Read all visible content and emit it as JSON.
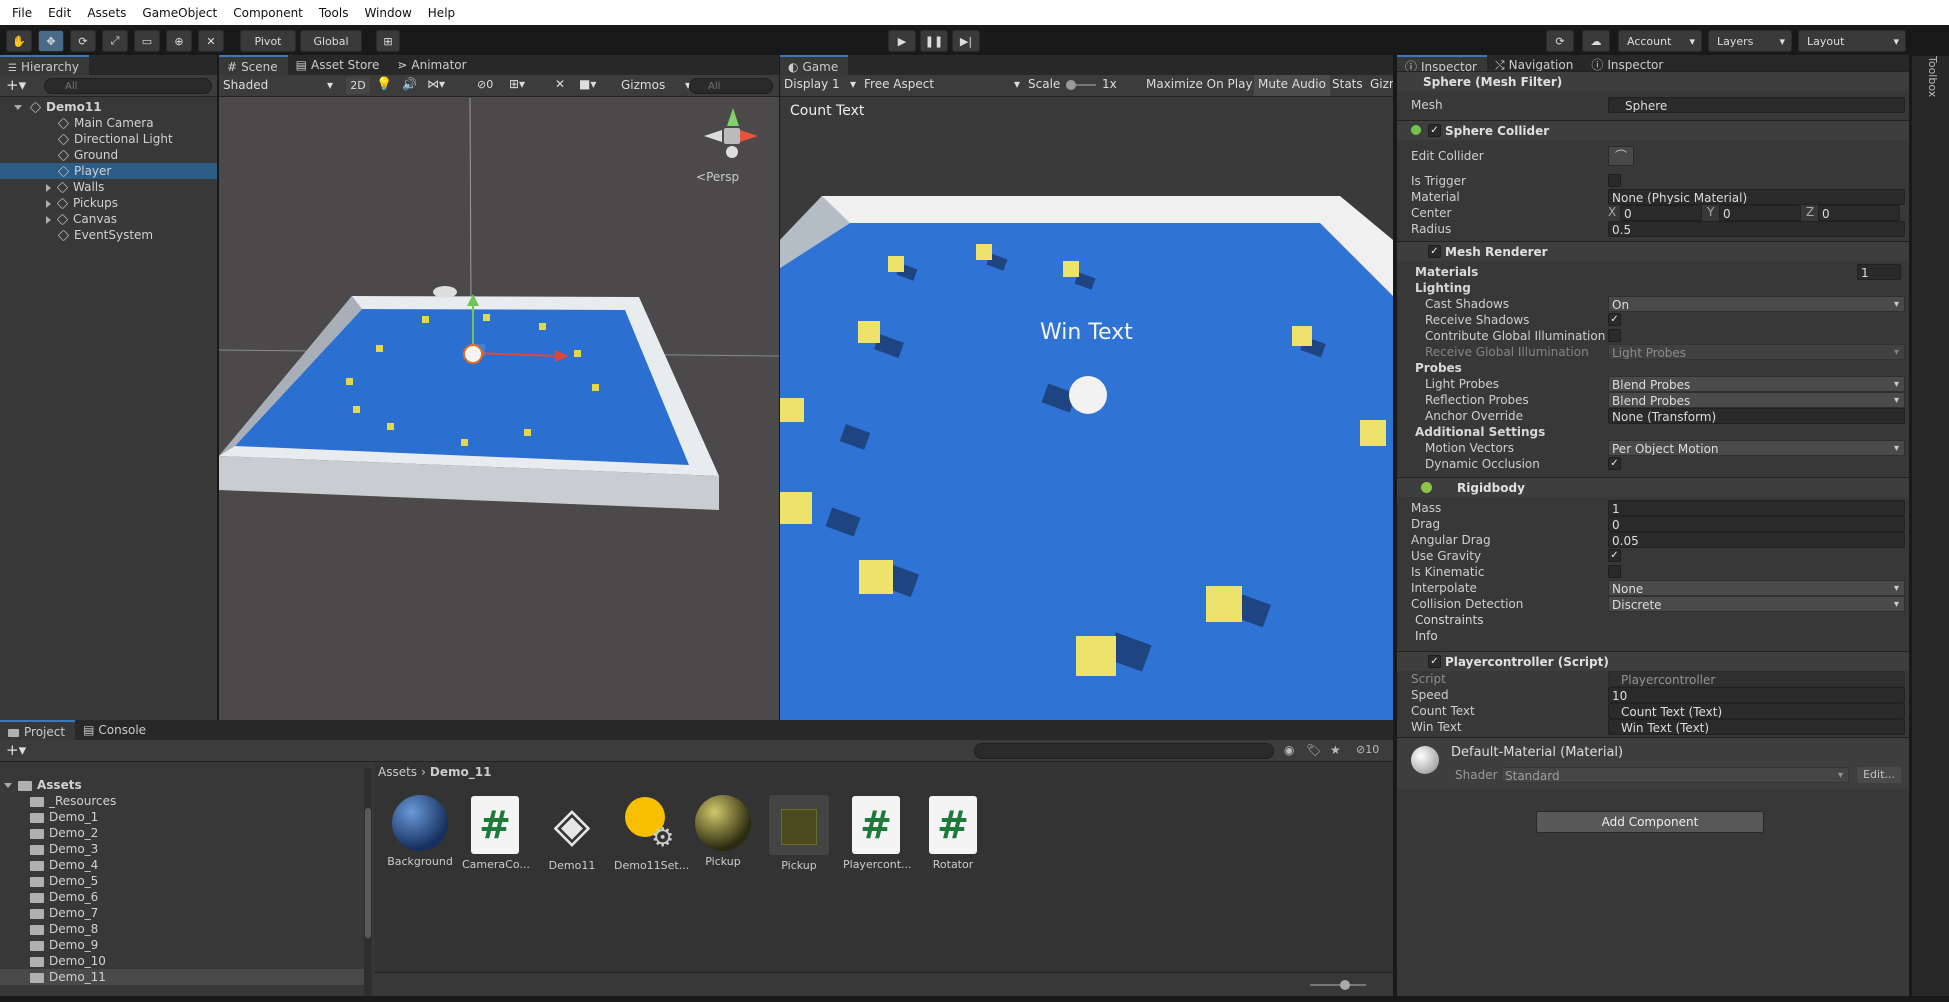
{
  "menu": [
    "File",
    "Edit",
    "Assets",
    "GameObject",
    "Component",
    "Tools",
    "Window",
    "Help"
  ],
  "toolbar": {
    "pivot": "Pivot",
    "global": "Global",
    "account": "Account",
    "layers": "Layers",
    "layout": "Layout",
    "toolbox": "Toolbox"
  },
  "hierarchy": {
    "tab": "Hierarchy",
    "search_placeholder": "All",
    "scene": "Demo11",
    "items": [
      {
        "label": "Main Camera"
      },
      {
        "label": "Directional Light"
      },
      {
        "label": "Ground"
      },
      {
        "label": "Player"
      },
      {
        "label": "Walls"
      },
      {
        "label": "Pickups"
      },
      {
        "label": "Canvas"
      },
      {
        "label": "EventSystem"
      }
    ]
  },
  "scene_view": {
    "tabs": [
      "Scene",
      "Asset Store",
      "Animator"
    ],
    "shading": "Shaded",
    "mode_2d": "2D",
    "hidden_count": "0",
    "gizmos": "Gizmos",
    "search_placeholder": "All",
    "persp": "Persp"
  },
  "game_view": {
    "tab": "Game",
    "display": "Display 1",
    "aspect": "Free Aspect",
    "scale_label": "Scale",
    "scale_value": "1x",
    "maximize": "Maximize On Play",
    "mute": "Mute Audio",
    "stats": "Stats",
    "gizmos": "Gizm",
    "count_text": "Count Text",
    "win_text": "Win Text"
  },
  "inspector": {
    "tabs": [
      "Inspector",
      "Navigation",
      "Inspector"
    ],
    "mesh_filter": {
      "title": "Sphere (Mesh Filter)",
      "mesh_label": "Mesh",
      "mesh_value": "Sphere"
    },
    "sphere_collider": {
      "title": "Sphere Collider",
      "edit_collider": "Edit Collider",
      "is_trigger": "Is Trigger",
      "material_label": "Material",
      "material_value": "None (Physic Material)",
      "center_label": "Center",
      "cx": "0",
      "cy": "0",
      "cz": "0",
      "radius_label": "Radius",
      "radius_value": "0.5"
    },
    "mesh_renderer": {
      "title": "Mesh Renderer",
      "materials": "Materials",
      "materials_count": "1",
      "lighting": "Lighting",
      "cast_shadows": "Cast Shadows",
      "cast_shadows_value": "On",
      "receive_shadows": "Receive Shadows",
      "contribute_gi": "Contribute Global Illumination",
      "receive_gi": "Receive Global Illumination",
      "receive_gi_value": "Light Probes",
      "probes": "Probes",
      "light_probes": "Light Probes",
      "light_probes_value": "Blend Probes",
      "reflection_probes": "Reflection Probes",
      "reflection_probes_value": "Blend Probes",
      "anchor_override": "Anchor Override",
      "anchor_override_value": "None (Transform)",
      "additional": "Additional Settings",
      "motion_vectors": "Motion Vectors",
      "motion_vectors_value": "Per Object Motion",
      "dynamic_occlusion": "Dynamic Occlusion"
    },
    "rigidbody": {
      "title": "Rigidbody",
      "mass": "Mass",
      "mass_value": "1",
      "drag": "Drag",
      "drag_value": "0",
      "angular_drag": "Angular Drag",
      "angular_drag_value": "0.05",
      "use_gravity": "Use Gravity",
      "is_kinematic": "Is Kinematic",
      "interpolate": "Interpolate",
      "interpolate_value": "None",
      "collision": "Collision Detection",
      "collision_value": "Discrete",
      "constraints": "Constraints",
      "info": "Info"
    },
    "player_script": {
      "title": "Playercontroller (Script)",
      "script": "Script",
      "script_value": "Playercontroller",
      "speed": "Speed",
      "speed_value": "10",
      "count_text": "Count Text",
      "count_text_value": "Count Text (Text)",
      "win_text": "Win Text",
      "win_text_value": "Win Text (Text)"
    },
    "material": {
      "title": "Default-Material (Material)",
      "shader": "Shader",
      "shader_value": "Standard",
      "edit": "Edit..."
    },
    "add_component": "Add Component"
  },
  "project": {
    "tabs": [
      "Project",
      "Console"
    ],
    "hidden_count": "10",
    "root": "Assets",
    "folders": [
      "_Resources",
      "Demo_1",
      "Demo_2",
      "Demo_3",
      "Demo_4",
      "Demo_5",
      "Demo_6",
      "Demo_7",
      "Demo_8",
      "Demo_9",
      "Demo_10",
      "Demo_11"
    ],
    "breadcrumb": [
      "Assets",
      "Demo_11"
    ],
    "assets": [
      "Background",
      "CameraCo...",
      "Demo11",
      "Demo11Set...",
      "Pickup",
      "Pickup",
      "Playercont...",
      "Rotator"
    ]
  },
  "colors": {
    "accent": "#3a79bb",
    "selection": "#2c5d87",
    "floor": "#2f73d4",
    "pickup": "#ebe25a",
    "editor_bg": "#383838"
  }
}
